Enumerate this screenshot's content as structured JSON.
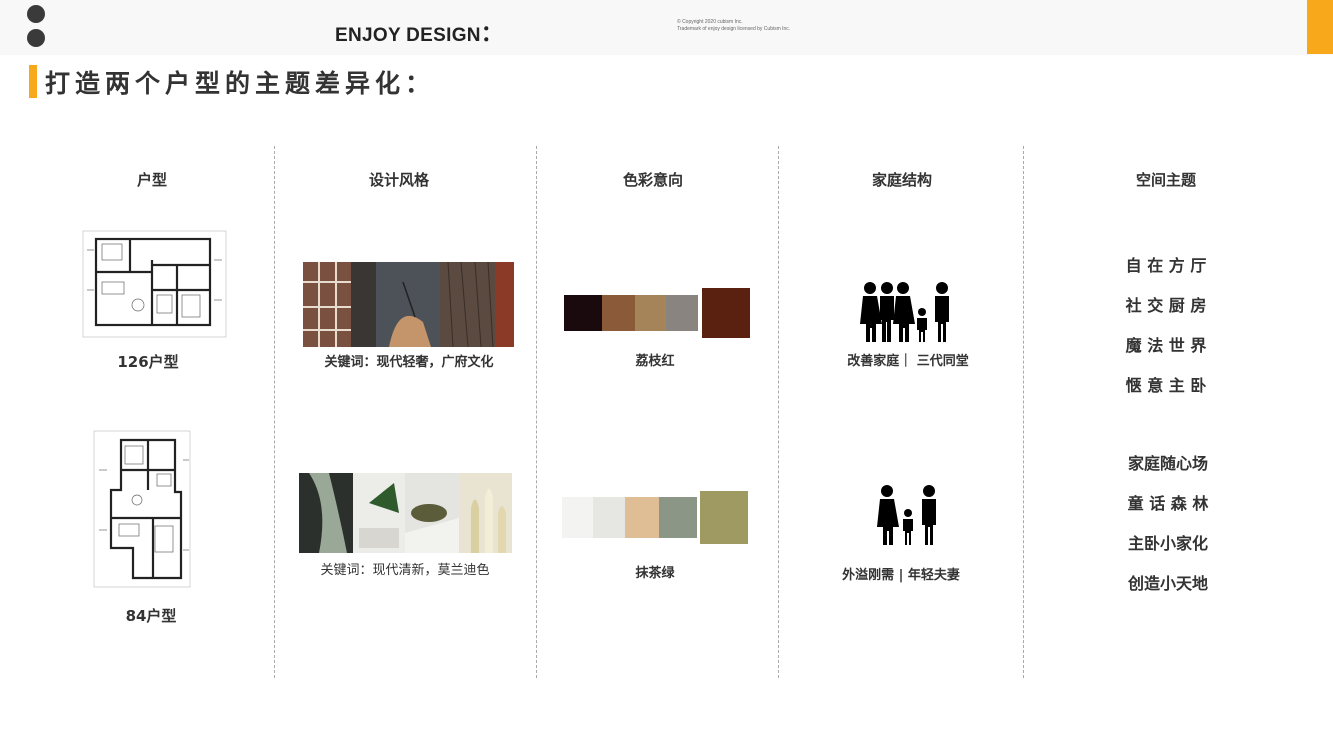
{
  "header": {
    "brand": "ENJOY DESIGN",
    "brand_mark": "：",
    "copyright_line1": "©    Copyright 2020 cubism Inc.",
    "copyright_line2": "Trademark of enjoy design licensed by Cubism Inc.",
    "accent_color": "#f7a81b"
  },
  "title": "打造两个户型的主题差异化：",
  "columns": {
    "unit": "户型",
    "style": "设计风格",
    "color": "色彩意向",
    "family": "家庭结构",
    "theme": "空间主题"
  },
  "rows": [
    {
      "unit_label": "126户型",
      "style_keywords": "关键词：现代轻奢，广府文化",
      "color_name": "荔枝红",
      "palette": [
        "#1a0a0d",
        "#8b5a38",
        "#a6845a",
        "#8a8480"
      ],
      "accent_swatch": "#5b2110",
      "family_label": "改善家庭｜ 三代同堂",
      "family_icon": "three-generation-family-icon",
      "themes": [
        "自 在 方 厅",
        "社 交 厨 房",
        "魔 法 世 界",
        "惬 意 主 卧"
      ]
    },
    {
      "unit_label": "84户型",
      "style_keywords": "关键词：现代清新，莫兰迪色",
      "color_name": "抹茶绿",
      "palette": [
        "#f3f3f1",
        "#e6e6e2",
        "#dfbd95",
        "#8c9686"
      ],
      "accent_swatch": "#9f9a62",
      "family_label": "外溢刚需 | 年轻夫妻",
      "family_icon": "young-couple-family-icon",
      "themes": [
        "家庭随心场",
        "童 话 森 林",
        "主卧小家化",
        "创造小天地"
      ]
    }
  ]
}
